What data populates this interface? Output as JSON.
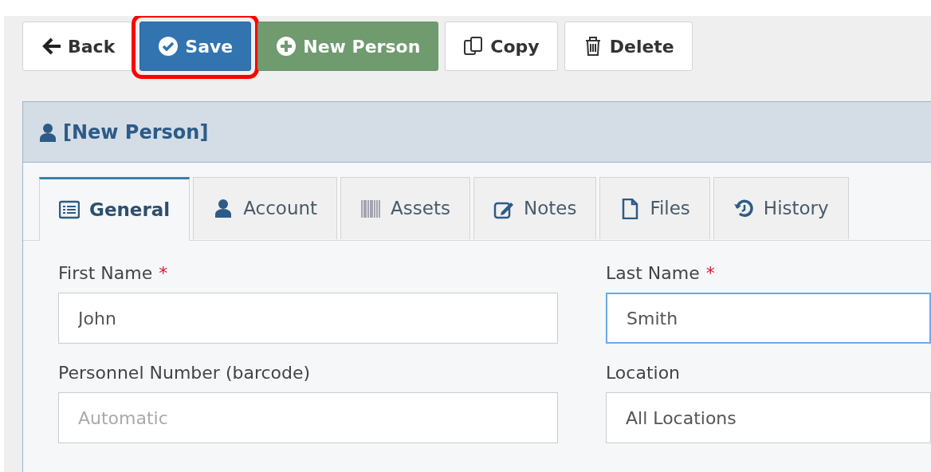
{
  "toolbar": [
    {
      "kind": "back",
      "label": "Back",
      "highlighted": false
    },
    {
      "kind": "save",
      "label": "Save",
      "highlighted": true
    },
    {
      "kind": "new",
      "label": "New Person",
      "highlighted": false
    },
    {
      "kind": "copy",
      "label": "Copy",
      "highlighted": false
    },
    {
      "kind": "delete",
      "label": "Delete",
      "highlighted": false
    }
  ],
  "panel": {
    "title": "[New Person]"
  },
  "tabs": [
    {
      "kind": "general",
      "label": "General",
      "selected": true
    },
    {
      "kind": "account",
      "label": "Account",
      "selected": false
    },
    {
      "kind": "assets",
      "label": "Assets",
      "selected": false
    },
    {
      "kind": "notes",
      "label": "Notes",
      "selected": false
    },
    {
      "kind": "files",
      "label": "Files",
      "selected": false
    },
    {
      "kind": "history",
      "label": "History",
      "selected": false
    }
  ],
  "fields": [
    {
      "label": "First Name",
      "required_mark": "*",
      "value": "John",
      "focused": false
    },
    {
      "label": "Last Name",
      "required_mark": "*",
      "value": "Smith",
      "focused": true
    },
    {
      "label": "Personnel Number (barcode)",
      "placeholder": "Automatic",
      "focused": false
    },
    {
      "label": "Location",
      "value": "All Locations",
      "focused": false
    }
  ]
}
